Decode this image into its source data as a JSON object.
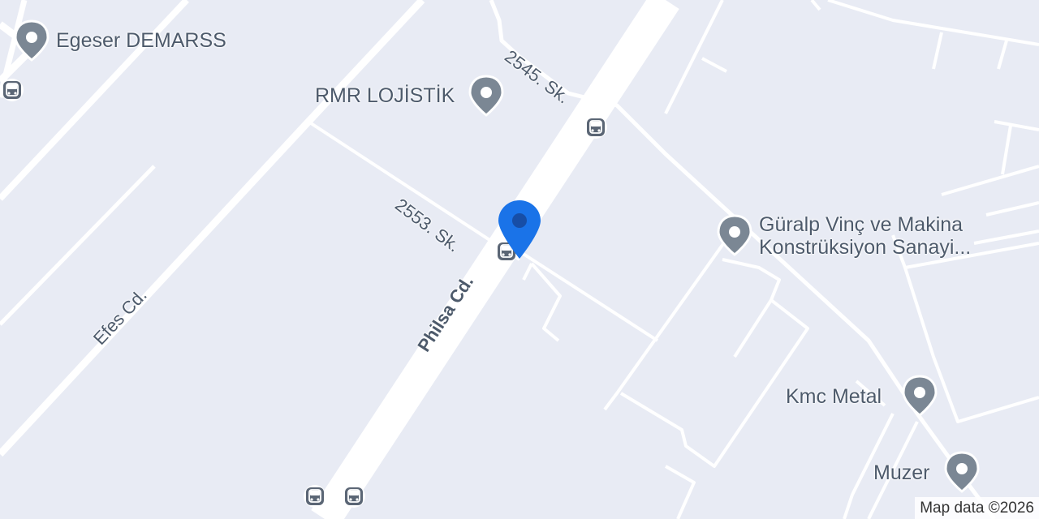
{
  "map": {
    "background_color": "#e8ebf4",
    "road_color": "#ffffff",
    "label_color": "#4d5a6b",
    "poi_pin_color": "#7b8794",
    "bus_icon_color": "#5b6675",
    "location_pin_color": "#1a73e8"
  },
  "streets": {
    "philsa": "Philsa Cd.",
    "efes": "Efes Cd.",
    "sk_2553": "2553. Sk.",
    "sk_2545": "2545. Sk."
  },
  "pois": [
    {
      "name": "Egeser DEMARSS",
      "icon": "place-icon"
    },
    {
      "name": "RMR LOJİSTİK",
      "icon": "place-icon"
    },
    {
      "name": "Güralp Vinç ve Makina",
      "icon": "place-icon"
    },
    {
      "name": "Konstrüksiyon Sanayi...",
      "icon": "place-icon"
    },
    {
      "name": "Kmc Metal",
      "icon": "place-icon"
    },
    {
      "name": "Muzer",
      "icon": "place-icon"
    }
  ],
  "bus_stops": [
    {
      "icon": "bus-stop-icon"
    },
    {
      "icon": "bus-stop-icon"
    },
    {
      "icon": "bus-stop-icon"
    },
    {
      "icon": "bus-stop-icon"
    },
    {
      "icon": "bus-stop-icon"
    }
  ],
  "selected_location": {
    "icon": "location-pin-icon"
  },
  "attribution": "Map data ©2026"
}
